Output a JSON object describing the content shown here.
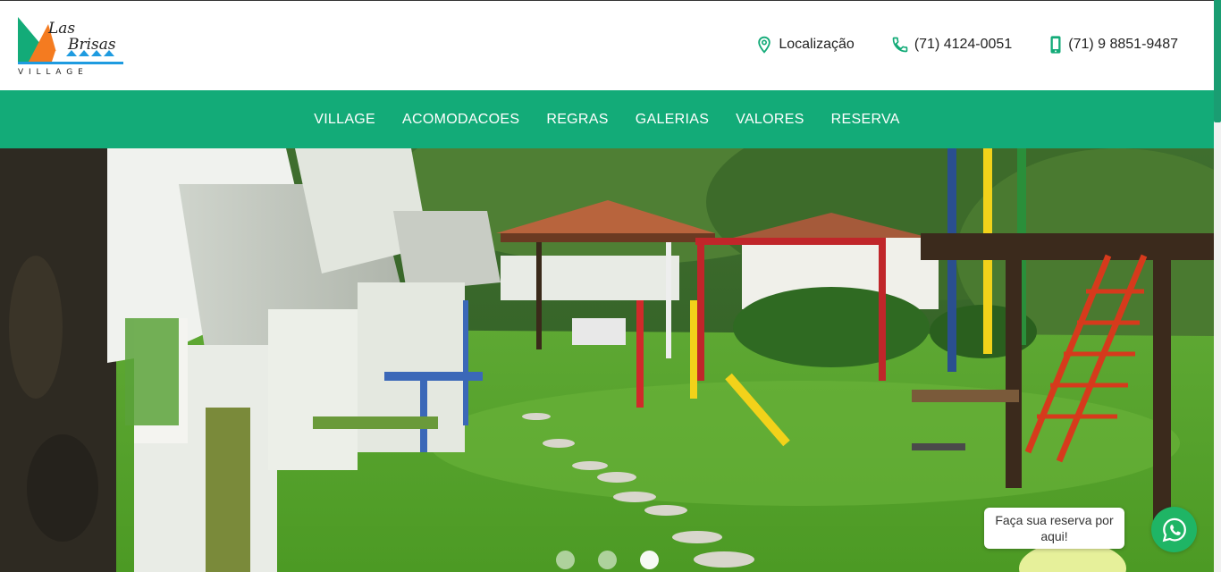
{
  "brand": {
    "logo_line1": "Las",
    "logo_line2": "Brisas",
    "logo_line3": "V I L L A G E"
  },
  "contacts": {
    "location_label": "Localização",
    "phone_label": "(71) 4124-0051",
    "mobile_label": "(71) 9 8851-9487"
  },
  "nav": {
    "items": [
      {
        "label": "VILLAGE"
      },
      {
        "label": "ACOMODACOES"
      },
      {
        "label": "REGRAS"
      },
      {
        "label": "GALERIAS"
      },
      {
        "label": "VALORES"
      },
      {
        "label": "RESERVA"
      }
    ]
  },
  "hero": {
    "slide_count": 3,
    "active_slide": 3
  },
  "whatsapp": {
    "tooltip": "Faça sua reserva por aqui!",
    "icon": "whatsapp-icon"
  },
  "colors": {
    "brand_green": "#13ab78",
    "whatsapp_green": "#1fb565",
    "logo_orange": "#f47b20",
    "logo_teal": "#13ab78"
  }
}
